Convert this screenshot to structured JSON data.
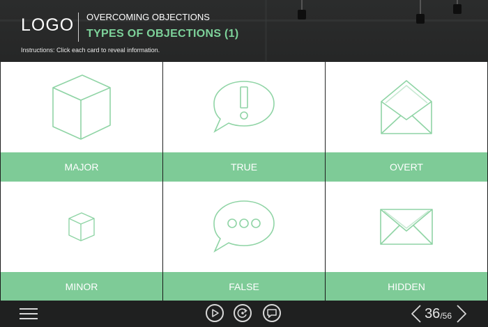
{
  "header": {
    "logo": "LOGO",
    "course_title": "OVERCOMING OBJECTIONS",
    "slide_title": "TYPES OF OBJECTIONS (1)",
    "instructions": "Instructions: Click each card to reveal information."
  },
  "cards": [
    {
      "label": "MAJOR",
      "icon": "large-cube-icon"
    },
    {
      "label": "TRUE",
      "icon": "speech-bubble-exclamation-icon"
    },
    {
      "label": "OVERT",
      "icon": "open-envelope-icon"
    },
    {
      "label": "MINOR",
      "icon": "small-cube-icon"
    },
    {
      "label": "FALSE",
      "icon": "speech-bubble-ellipsis-icon"
    },
    {
      "label": "HIDDEN",
      "icon": "closed-envelope-icon"
    }
  ],
  "footer": {
    "current_page": "36",
    "total_pages": "/56",
    "icons": [
      "menu-icon",
      "play-icon",
      "replay-icon",
      "transcript-icon",
      "prev-icon",
      "next-icon"
    ]
  },
  "colors": {
    "accent": "#7ecb97",
    "title": "#7dd29a",
    "icon_stroke": "#8fd4a5"
  }
}
